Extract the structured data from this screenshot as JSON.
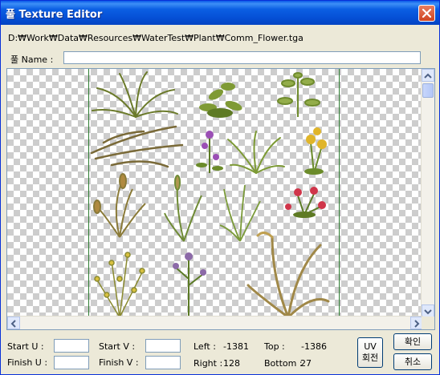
{
  "window": {
    "title": "풀 Texture Editor"
  },
  "texture": {
    "path": "D:₩Work₩Data₩Resources₩WaterTest₩Plant₩Comm_Flower.tga"
  },
  "name_field": {
    "label": "풀 Name :",
    "value": ""
  },
  "coords": {
    "start_u_label": "Start U :",
    "finish_u_label": "Finish U :",
    "start_v_label": "Start V :",
    "finish_v_label": "Finish V :",
    "start_u": "",
    "finish_u": "",
    "start_v": "",
    "finish_v": "",
    "left_label": "Left :",
    "left_value": "-1381",
    "top_label": "Top :",
    "top_value": "-1386",
    "right_label": "Right :",
    "right_value": "128",
    "bottom_label": "Bottom :",
    "bottom_value": "27"
  },
  "buttons": {
    "uv_rotate": [
      "UV",
      "회전"
    ],
    "ok": "확인",
    "cancel": "취소"
  },
  "colors": {
    "title_bar": "#0550d6",
    "guide_line": "#2e7d32",
    "checker": "#cdcdcd"
  },
  "icons": {
    "close": "close-icon"
  }
}
